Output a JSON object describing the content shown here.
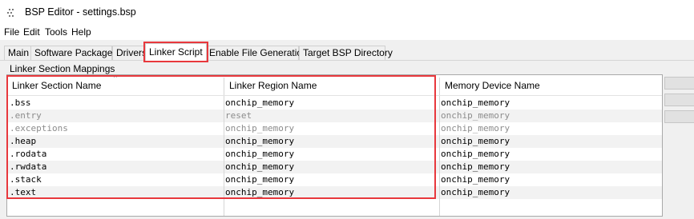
{
  "window": {
    "title": "BSP Editor - settings.bsp",
    "icon": "app-dots-icon"
  },
  "menubar": {
    "items": [
      "File",
      "Edit",
      "Tools",
      "Help"
    ]
  },
  "tabs": [
    {
      "label": "Main"
    },
    {
      "label": "Software Packages"
    },
    {
      "label": "Drivers"
    },
    {
      "label": "Linker Script",
      "active": true
    },
    {
      "label": "Enable File Generation"
    },
    {
      "label": "Target BSP Directory"
    }
  ],
  "section": {
    "label": "Linker Section Mappings"
  },
  "table": {
    "columns": [
      "Linker Section Name",
      "Linker Region Name",
      "Memory Device Name"
    ],
    "rows": [
      {
        "section": ".bss",
        "region": "onchip_memory",
        "device": "onchip_memory",
        "dimmed": false
      },
      {
        "section": ".entry",
        "region": "reset",
        "device": "onchip_memory",
        "dimmed": true
      },
      {
        "section": ".exceptions",
        "region": "onchip_memory",
        "device": "onchip_memory",
        "dimmed": true
      },
      {
        "section": ".heap",
        "region": "onchip_memory",
        "device": "onchip_memory",
        "dimmed": false
      },
      {
        "section": ".rodata",
        "region": "onchip_memory",
        "device": "onchip_memory",
        "dimmed": false
      },
      {
        "section": ".rwdata",
        "region": "onchip_memory",
        "device": "onchip_memory",
        "dimmed": false
      },
      {
        "section": ".stack",
        "region": "onchip_memory",
        "device": "onchip_memory",
        "dimmed": false
      },
      {
        "section": ".text",
        "region": "onchip_memory",
        "device": "onchip_memory",
        "dimmed": false
      }
    ]
  },
  "colors": {
    "highlight": "#e8383d",
    "dimmed_text": "#8c8c8c",
    "stripe": "#f2f2f2"
  }
}
